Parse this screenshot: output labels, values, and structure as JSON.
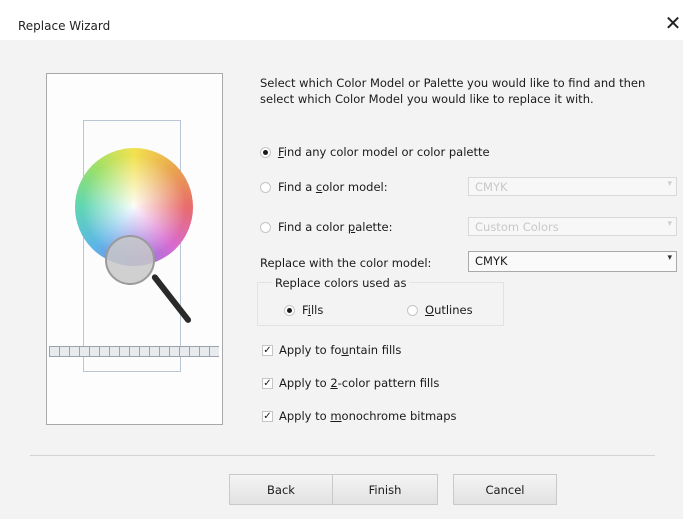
{
  "window": {
    "title": "Replace Wizard",
    "close_glyph": "✕"
  },
  "intro_text": "Select which Color Model or Palette you would like to find and then select which Color Model you would like to replace it with.",
  "find_options": {
    "any": {
      "label_pre": "",
      "label_u": "F",
      "label_post": "ind any color model or color palette",
      "selected": true
    },
    "model": {
      "label_pre": "Find a ",
      "label_u": "c",
      "label_post": "olor model:",
      "selected": false
    },
    "palette": {
      "label_pre": "Find a color ",
      "label_u": "p",
      "label_post": "alette:",
      "selected": false
    }
  },
  "model_dropdown": {
    "value": "CMYK",
    "enabled": false
  },
  "palette_dropdown": {
    "value": "Custom Colors",
    "enabled": false
  },
  "replace_with": {
    "label": "Replace with the color model:",
    "value": "CMYK"
  },
  "replace_group": {
    "label": "Replace colors used as",
    "fills": {
      "label_pre": "F",
      "label_u": "i",
      "label_post": "lls",
      "selected": true
    },
    "outlines": {
      "label_pre": "",
      "label_u": "O",
      "label_post": "utlines",
      "selected": false
    }
  },
  "checkboxes": [
    {
      "label_pre": "Apply to fo",
      "label_u": "u",
      "label_post": "ntain fills",
      "checked": true
    },
    {
      "label_pre": "Apply to ",
      "label_u": "2",
      "label_post": "-color pattern fills",
      "checked": true
    },
    {
      "label_pre": "Apply to ",
      "label_u": "m",
      "label_post": "onochrome bitmaps",
      "checked": true
    }
  ],
  "check_glyph": "✓",
  "arrow_glyph": "▾",
  "buttons": {
    "back": "Back",
    "finish": "Finish",
    "cancel": "Cancel"
  }
}
